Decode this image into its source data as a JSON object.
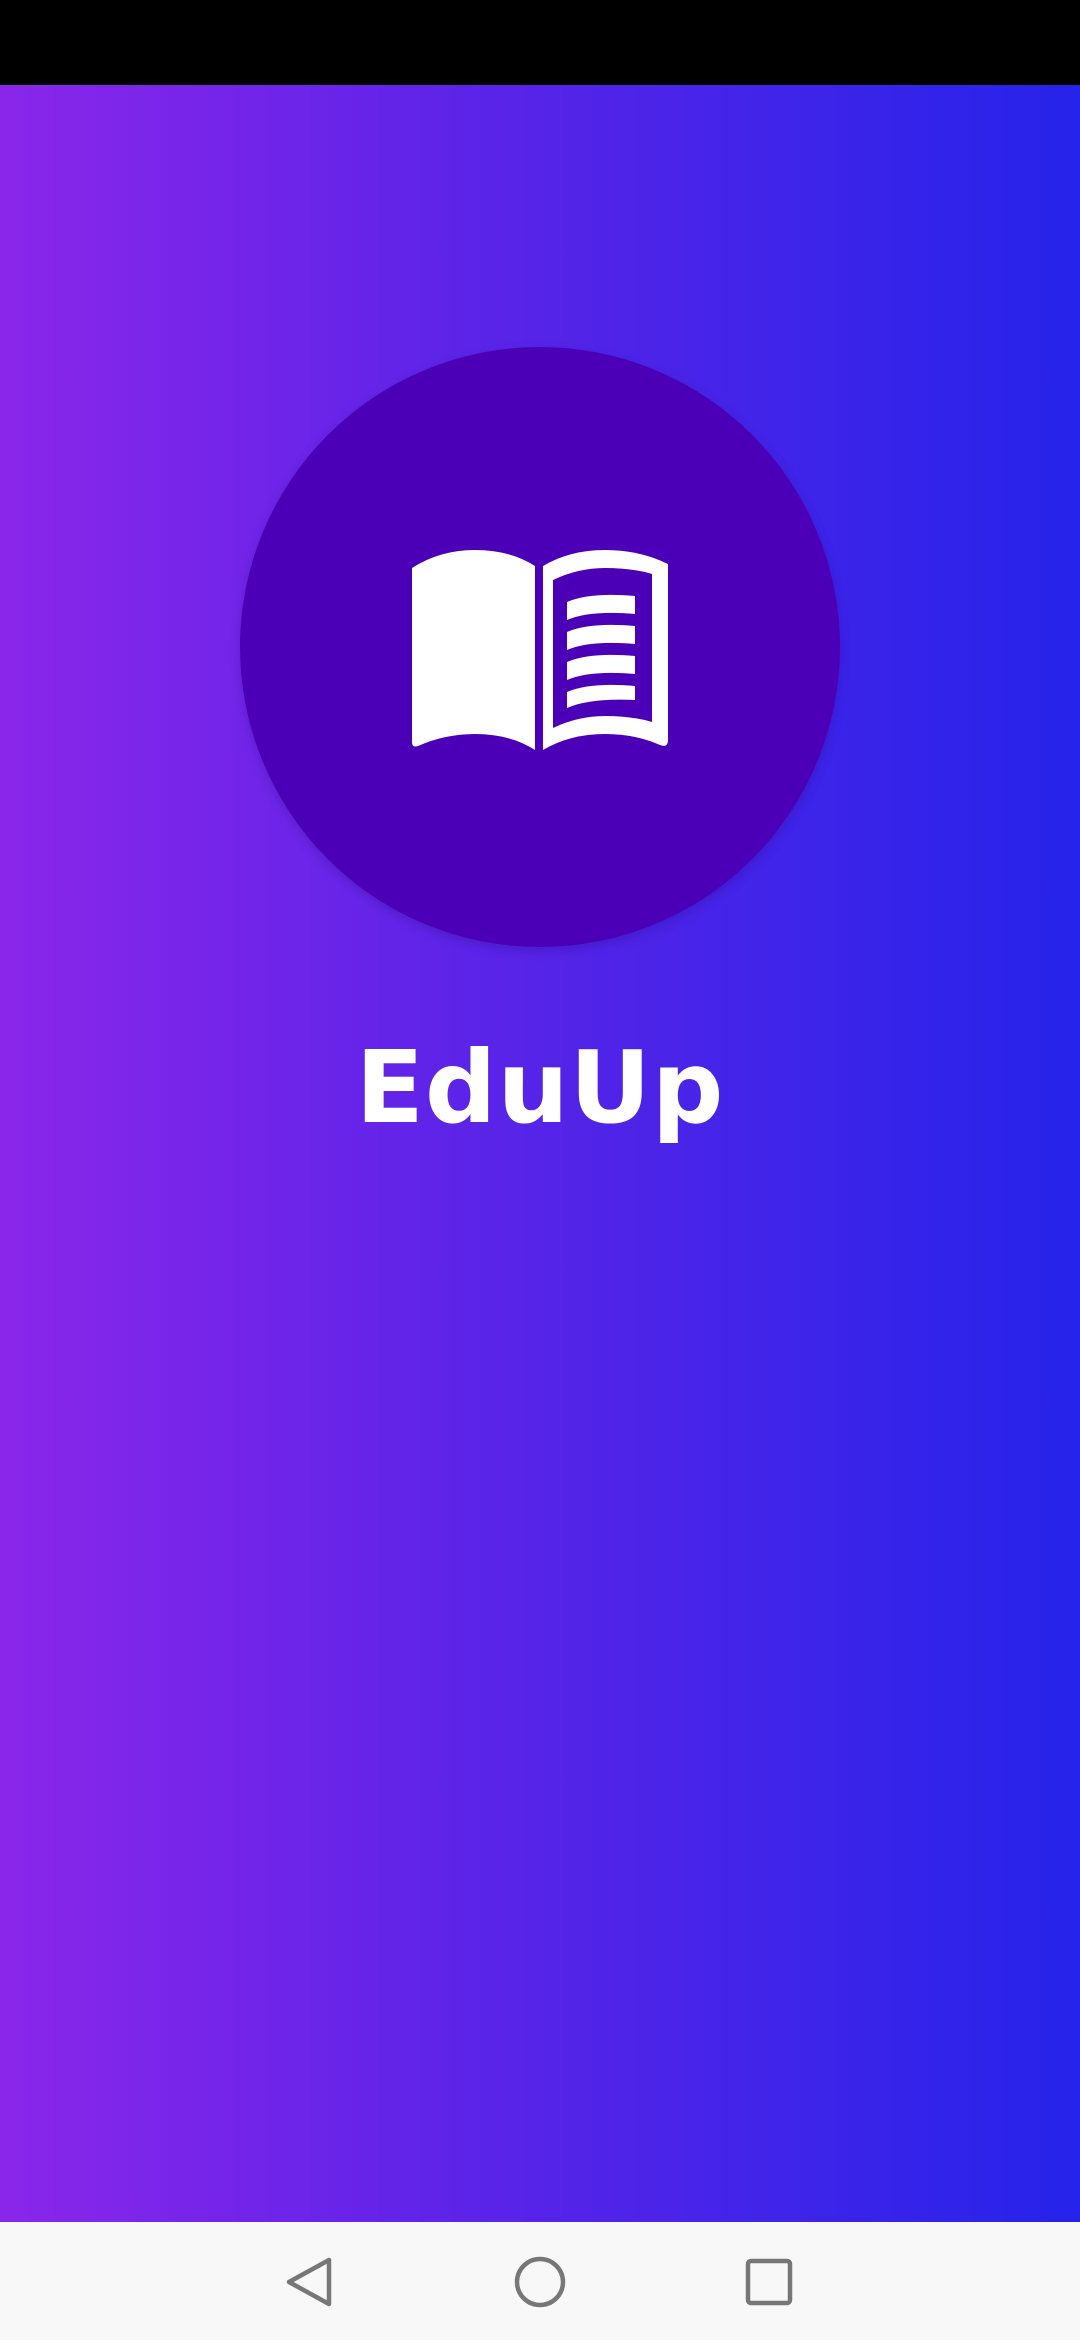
{
  "app": {
    "title": "EduUp",
    "logo_icon": "open-book-icon",
    "colors": {
      "gradient_start": "#8a26ea",
      "gradient_end": "#2623ea",
      "circle": "#4b00b8",
      "title_text": "#ffffff"
    }
  },
  "navigation_bar": {
    "buttons": [
      {
        "icon": "back-triangle-icon"
      },
      {
        "icon": "home-circle-icon"
      },
      {
        "icon": "recents-square-icon"
      }
    ]
  }
}
